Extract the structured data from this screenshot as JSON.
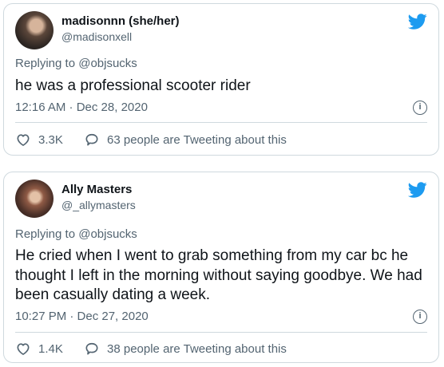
{
  "colors": {
    "accent": "#1d9bf0",
    "text": "#0f1419",
    "secondary": "#536471",
    "border": "#cfd9de"
  },
  "tweets": [
    {
      "name": "madisonnn (she/her)",
      "handle": "@madisonxell",
      "replying": "Replying to @objsucks",
      "text": "he was a professional scooter rider",
      "timestamp": "12:16 AM · Dec 28, 2020",
      "likes": "3.3K",
      "tweeting": "63 people are Tweeting about this",
      "icons": {
        "like": "heart-icon",
        "comment": "comment-icon",
        "info": "info-icon",
        "brand": "twitter-bird-icon"
      }
    },
    {
      "name": "Ally Masters",
      "handle": "@_allymasters",
      "replying": "Replying to @objsucks",
      "text": "He cried when I went to grab something from my car bc he thought I left in the morning without saying goodbye. We had been casually dating a week.",
      "timestamp": "10:27 PM · Dec 27, 2020",
      "likes": "1.4K",
      "tweeting": "38 people are Tweeting about this",
      "icons": {
        "like": "heart-icon",
        "comment": "comment-icon",
        "info": "info-icon",
        "brand": "twitter-bird-icon"
      }
    }
  ]
}
